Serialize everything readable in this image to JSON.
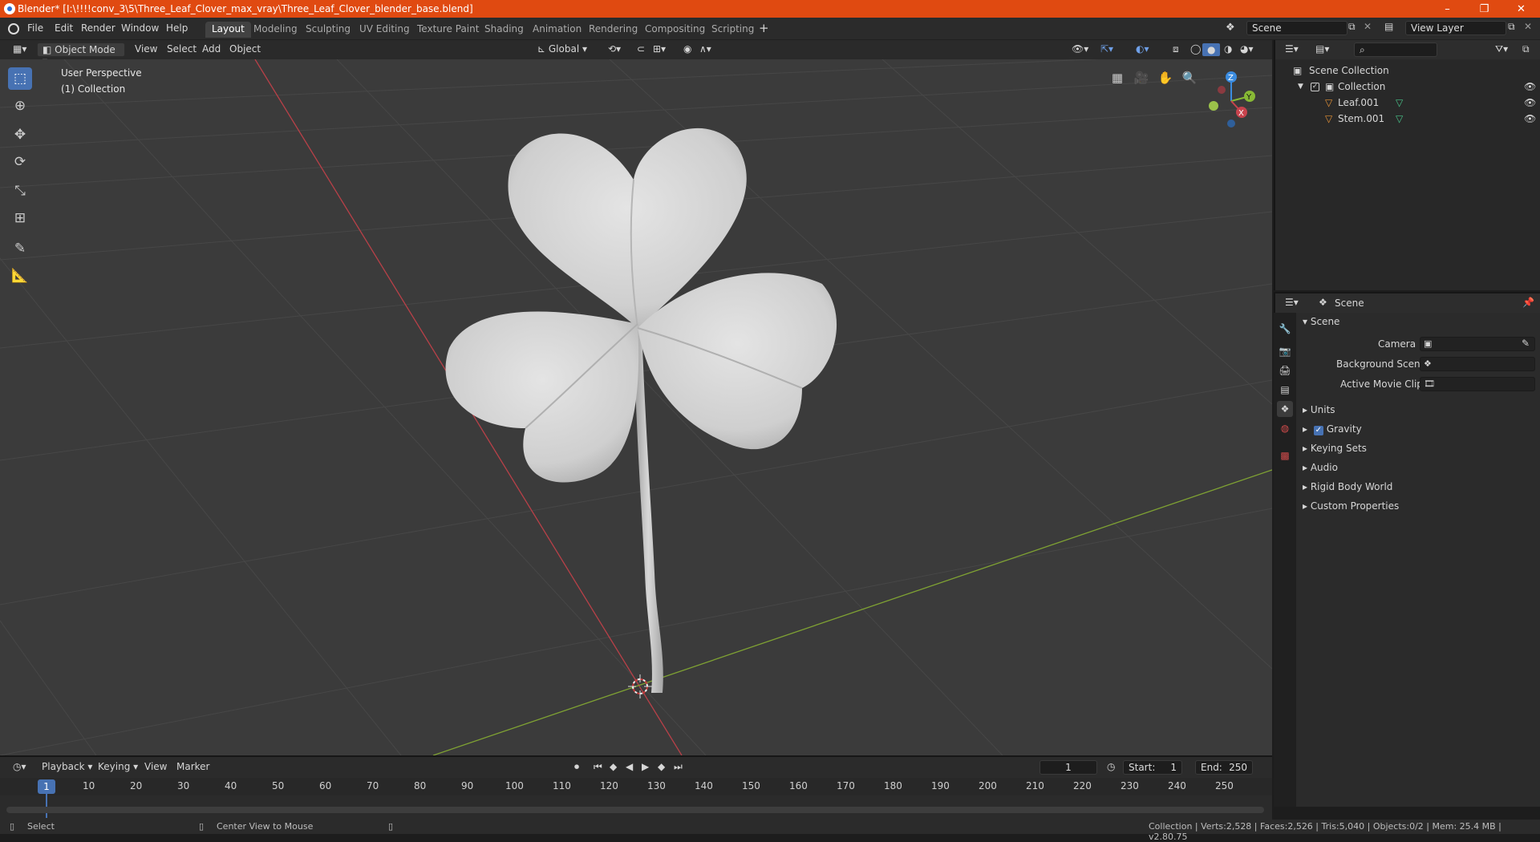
{
  "window": {
    "title": "Blender* [I:\\!!!!conv_3\\5\\Three_Leaf_Clover_max_vray\\Three_Leaf_Clover_blender_base.blend]",
    "controls": [
      "–",
      "❐",
      "✕"
    ]
  },
  "menu": [
    "File",
    "Edit",
    "Render",
    "Window",
    "Help"
  ],
  "workspaces": [
    "Layout",
    "Modeling",
    "Sculpting",
    "UV Editing",
    "Texture Paint",
    "Shading",
    "Animation",
    "Rendering",
    "Compositing",
    "Scripting"
  ],
  "active_workspace": "Layout",
  "scene_field": "Scene",
  "view_layer_field": "View Layer",
  "viewport_header": {
    "mode": "Object Mode",
    "menus": [
      "View",
      "Select",
      "Add",
      "Object"
    ],
    "transform_orientation": "Global"
  },
  "viewport": {
    "view_name": "User Perspective",
    "collection_label": "(1) Collection",
    "gizmo_axes": [
      "Z",
      "Y",
      "X"
    ]
  },
  "tools": [
    "select-box",
    "cursor",
    "move",
    "rotate",
    "scale",
    "transform",
    "annotate",
    "measure"
  ],
  "outliner": {
    "root": "Scene Collection",
    "collection": "Collection",
    "objects": [
      "Leaf.001",
      "Stem.001"
    ]
  },
  "properties": {
    "header": "Scene",
    "panel": "Scene",
    "fields": [
      "Camera",
      "Background Scene",
      "Active Movie Clip"
    ],
    "subpanels": [
      "Units",
      "Gravity",
      "Keying Sets",
      "Audio",
      "Rigid Body World",
      "Custom Properties"
    ],
    "gravity_checked": true
  },
  "timeline": {
    "menus": [
      "Playback",
      "Keying",
      "View",
      "Marker"
    ],
    "current_frame": "1",
    "start_label": "Start:",
    "start": "1",
    "end_label": "End:",
    "end": "250",
    "ticks": [
      "10",
      "20",
      "30",
      "40",
      "50",
      "60",
      "70",
      "80",
      "90",
      "100",
      "110",
      "120",
      "130",
      "140",
      "150",
      "160",
      "170",
      "180",
      "190",
      "200",
      "210",
      "220",
      "230",
      "240",
      "250"
    ]
  },
  "statusbar": {
    "left": "Select",
    "middle": "Center View to Mouse",
    "stats": "Collection | Verts:2,528 | Faces:2,526 | Tris:5,040 | Objects:0/2 | Mem: 25.4 MB | v2.80.75"
  },
  "colors": {
    "accent": "#4772b3",
    "titlebar": "#e04a11",
    "x_axis": "#c8434d",
    "y_axis": "#88b935",
    "z_axis": "#3b8ce0"
  }
}
